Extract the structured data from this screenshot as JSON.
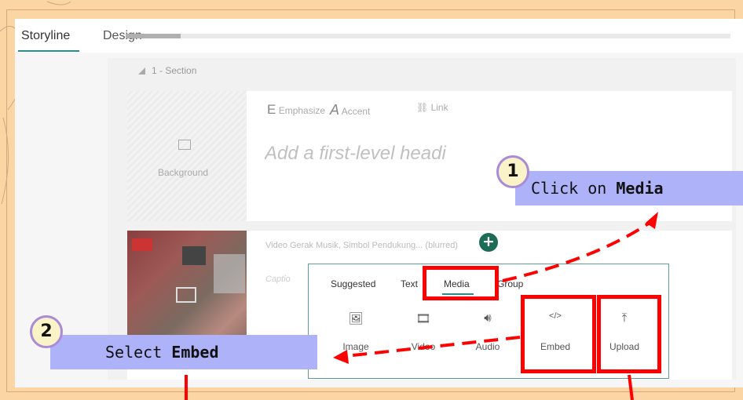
{
  "tabs": [
    {
      "label": "Storyline"
    },
    {
      "label": "Design"
    }
  ],
  "section": {
    "title": "1 - Section"
  },
  "format_bar": {
    "emphasize": "Emphasize",
    "accent": "Accent",
    "link": "Link"
  },
  "background_tile": {
    "label": "Background",
    "icon": "image-icon"
  },
  "heading_placeholder": "Add a first-level headi",
  "video_block": {
    "meta": "Video Gerak Musik, Simbol Pendukung... (blurred)",
    "caption_placeholder": "Captio"
  },
  "popover": {
    "tabs": [
      "Suggested",
      "Text",
      "Media",
      "Group"
    ],
    "selected_tab": "Media",
    "items": [
      {
        "label": "Image",
        "icon": "image-icon"
      },
      {
        "label": "Video",
        "icon": "film-icon"
      },
      {
        "label": "Audio",
        "icon": "speaker-icon"
      },
      {
        "label": "Embed",
        "icon": "code-icon"
      },
      {
        "label": "Upload",
        "icon": "upload-icon"
      }
    ]
  },
  "callouts": {
    "step1": {
      "number": "1",
      "prefix": "Click on ",
      "bold": "Media"
    },
    "step2": {
      "number": "2",
      "prefix": "Select ",
      "bold": "Embed"
    }
  },
  "colors": {
    "accent": "#2e8a8a",
    "highlight": "#ff0000",
    "callout": "#aeb2f8",
    "background": "#fcd5a4",
    "plus": "#1d6d56"
  }
}
